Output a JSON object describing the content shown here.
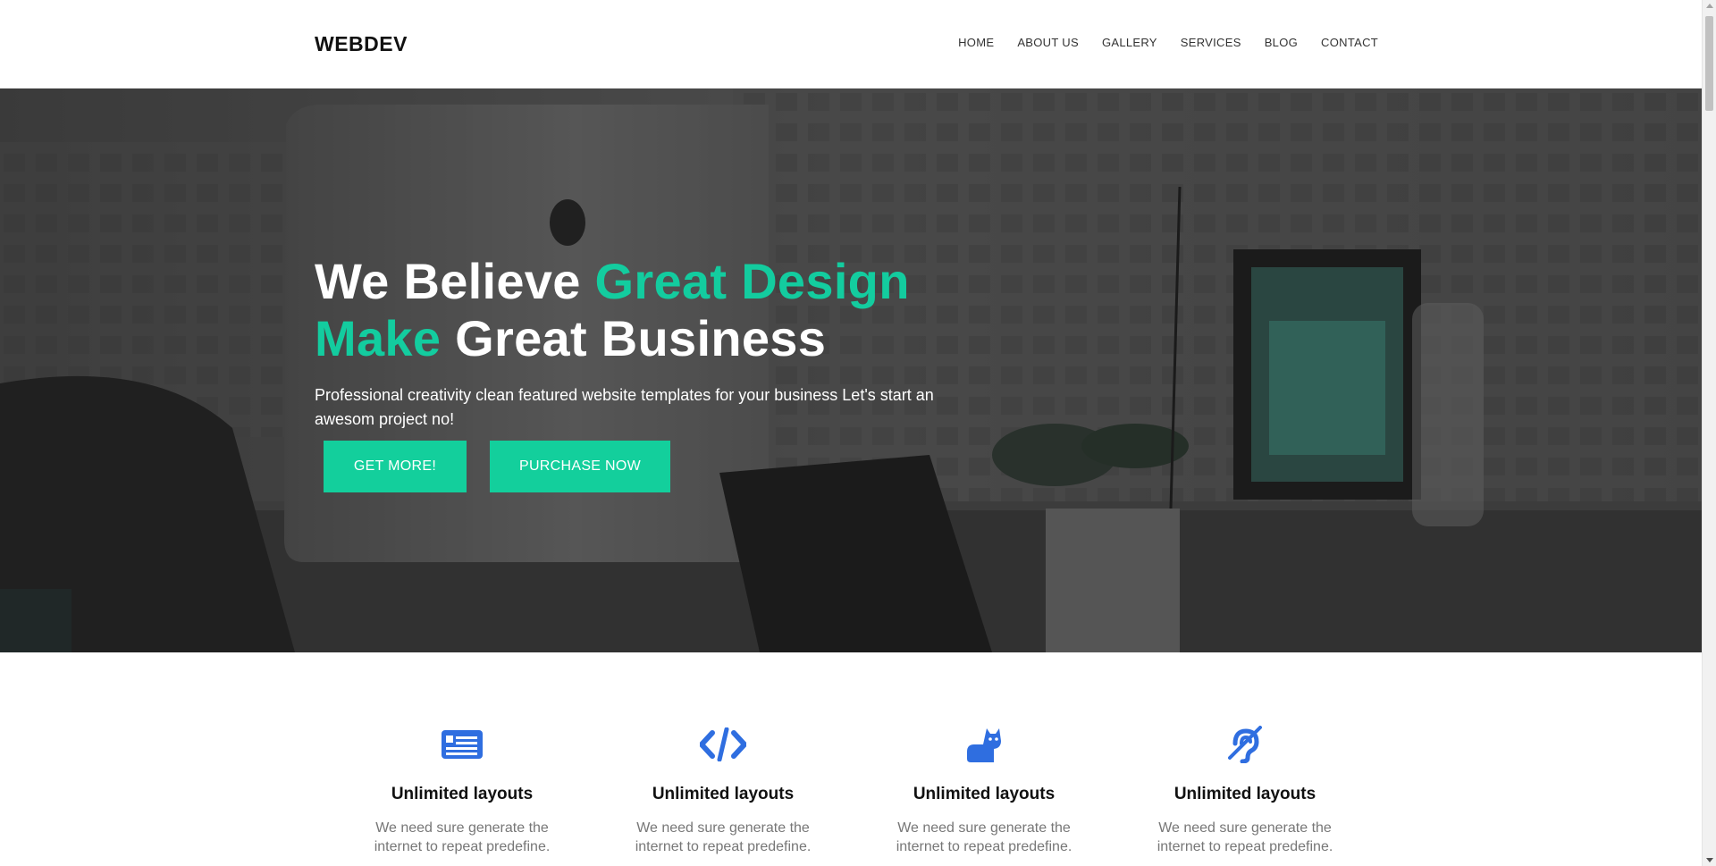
{
  "brand": "WEBDEV",
  "nav": [
    "HOME",
    "ABOUT US",
    "GALLERY",
    "SERVICES",
    "BLOG",
    "CONTACT"
  ],
  "hero": {
    "title_part1": "We Believe ",
    "title_accent1": "Great Design",
    "title_accent2": "Make",
    "title_part2": " Great Business",
    "subtitle": "Professional creativity clean featured website templates for your business Let's start an awesom project no!",
    "btn_more": "GET MORE!",
    "btn_buy": "PURCHASE NOW"
  },
  "features": [
    {
      "icon": "newspaper-icon",
      "title": "Unlimited layouts",
      "desc_line1": "We need sure generate the",
      "desc_line2": "internet to repeat predefine."
    },
    {
      "icon": "code-icon",
      "title": "Unlimited layouts",
      "desc_line1": "We need sure generate the",
      "desc_line2": "internet to repeat predefine."
    },
    {
      "icon": "cat-icon",
      "title": "Unlimited layouts",
      "desc_line1": "We need sure generate the",
      "desc_line2": "internet to repeat predefine."
    },
    {
      "icon": "hearing-icon",
      "title": "Unlimited layouts",
      "desc_line1": "We need sure generate the",
      "desc_line2": "internet to repeat predefine."
    }
  ],
  "colors": {
    "accent": "#13cc9f",
    "icon": "#2f6ee0"
  }
}
